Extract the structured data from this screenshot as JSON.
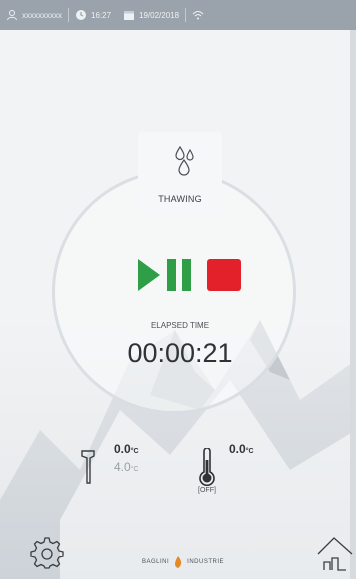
{
  "status_bar": {
    "user": "xxxxxxxxxx",
    "time": "16:27",
    "date": "19/02/2018",
    "indicators": "",
    "icons": [
      "user-icon",
      "clock-icon",
      "calendar-icon",
      "wifi-icon"
    ]
  },
  "program": {
    "mode_label": "THAWING",
    "mode_icon": "water-drops-icon"
  },
  "controls": {
    "play_pause_icon": "play-pause-icon",
    "stop_icon": "stop-icon",
    "play_color": "#2e9e47",
    "stop_color": "#e3212b"
  },
  "timer": {
    "label": "ELAPSED TIME",
    "value": "00:00:21"
  },
  "core_probe": {
    "value": "0.0",
    "unit": "°C",
    "setpoint": "4.0",
    "setpoint_unit": "°C",
    "icon": "core-probe-icon"
  },
  "chamber": {
    "value": "0.0",
    "unit": "°C",
    "status": "[OFF]",
    "icon": "thermometer-icon"
  },
  "footer": {
    "brand_left": "BAGLINI",
    "brand_right": "INDUSTRIE",
    "settings_icon": "settings-icon",
    "home_icon": "home-icon"
  }
}
